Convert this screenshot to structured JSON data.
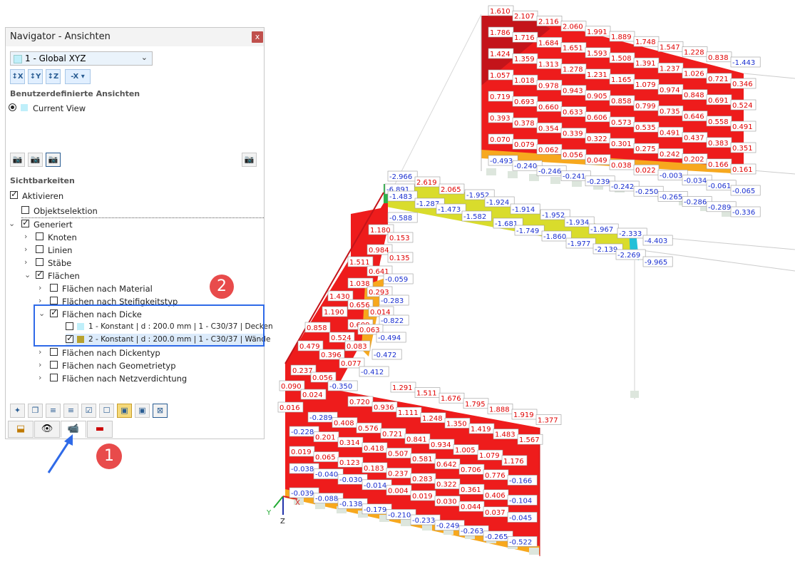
{
  "navigator": {
    "title": "Navigator - Ansichten",
    "close_label": "x",
    "view_select": "1 - Global XYZ",
    "axis_buttons": [
      "Ṫ X",
      "Y",
      "Z",
      "-X"
    ],
    "section_user_views": "Benutzerdefinierte Ansichten",
    "current_view": "Current View",
    "section_visibility": "Sichtbarkeiten",
    "tree": {
      "activate": "Aktivieren",
      "object_selection": "Objektselektion",
      "generated": "Generiert",
      "nodes": "Knoten",
      "lines": "Linien",
      "members": "Stäbe",
      "surfaces": "Flächen",
      "by_material": "Flächen nach Material",
      "by_stiffness": "Flächen nach Steifigkeitstyp",
      "by_thickness": "Flächen nach Dicke",
      "thickness_1": "1 - Konstant | d : 200.0 mm | 1 - C30/37 | Decken",
      "thickness_2": "2 - Konstant | d : 200.0 mm | 1 - C30/37 | Wände",
      "by_thickness_type": "Flächen nach Dickentyp",
      "by_geometry": "Flächen nach Geometrietyp",
      "by_mesh": "Flächen nach Netzverdichtung"
    },
    "colors": {
      "thickness_1": "#bfeffa",
      "thickness_2": "#b8a22e"
    }
  },
  "markers": {
    "one": "1",
    "two": "2"
  },
  "viewport": {
    "axis_labels": {
      "x": "X",
      "y": "Y",
      "z": "Z"
    },
    "colors": {
      "red": "#ee1c1c",
      "darkred": "#c4141a",
      "orange": "#f7a81e",
      "yellow": "#d9dc2c",
      "pos_text": "#e00000",
      "neg_text": "#1a2fd0"
    },
    "top_wall_labels": [
      "1.610",
      "2.107",
      "2.116",
      "2.060",
      "1.991",
      "1.889",
      "1.748",
      "1.547",
      "1.228",
      "0.838",
      "-1.443",
      "1.786",
      "1.716",
      "1.684",
      "1.651",
      "1.593",
      "1.508",
      "1.391",
      "1.237",
      "1.026",
      "0.721",
      "0.346",
      "1.424",
      "1.359",
      "1.313",
      "1.278",
      "1.231",
      "1.165",
      "1.079",
      "0.974",
      "0.848",
      "0.691",
      "0.524",
      "1.057",
      "1.018",
      "0.978",
      "0.943",
      "0.905",
      "0.858",
      "0.799",
      "0.735",
      "0.646",
      "0.558",
      "0.491",
      "0.719",
      "0.693",
      "0.660",
      "0.633",
      "0.606",
      "0.573",
      "0.535",
      "0.491",
      "0.437",
      "0.383",
      "0.351",
      "0.393",
      "0.378",
      "0.354",
      "0.339",
      "0.322",
      "0.301",
      "0.275",
      "0.242",
      "0.202",
      "0.166",
      "0.161",
      "0.070",
      "0.079",
      "0.062",
      "0.056",
      "0.049",
      "0.038",
      "0.022",
      "-0.003",
      "-0.034",
      "-0.061",
      "-0.065",
      "-0.493",
      "-0.240",
      "-0.246",
      "-0.241",
      "-0.239",
      "-0.242",
      "-0.250",
      "-0.265",
      "-0.286",
      "-0.289",
      "-0.336"
    ],
    "beam_labels": [
      "-2.966",
      "-6.891",
      "2.619",
      "-1.483",
      "2.065",
      "-1.952",
      "-1.287",
      "-1.473",
      "-1.582",
      "-1.924",
      "-1.914",
      "-1.952",
      "-1.934",
      "-1.967",
      "-2.333",
      "-4.403",
      "-0.588",
      "-1.681",
      "-1.749",
      "-1.860",
      "-1.977",
      "-2.139",
      "-2.269",
      "-9.965"
    ],
    "side_wall_labels": [
      "1.180",
      "0.153",
      "0.984",
      "0.135",
      "1.511",
      "0.641",
      "-0.059",
      "1.038",
      "0.293",
      "1.430",
      "0.656",
      "-0.283",
      "1.190",
      "0.609",
      "0.014",
      "-0.822",
      "0.858",
      "0.524",
      "0.063",
      "-0.494",
      "0.479",
      "0.396",
      "0.083",
      "-0.472",
      "0.237",
      "0.077",
      "-0.412",
      "0.056",
      "0.090",
      "0.024",
      "-0.350",
      "0.016"
    ],
    "bottom_wall_labels": [
      "1.291",
      "1.511",
      "1.676",
      "1.795",
      "1.888",
      "1.919",
      "1.377",
      "0.720",
      "0.936",
      "1.111",
      "1.248",
      "1.350",
      "1.419",
      "1.483",
      "1.567",
      "-0.289",
      "0.408",
      "0.576",
      "0.721",
      "0.841",
      "0.934",
      "1.005",
      "1.079",
      "1.176",
      "-0.228",
      "0.201",
      "0.314",
      "0.418",
      "0.507",
      "0.581",
      "0.642",
      "0.706",
      "0.776",
      "-0.166",
      "0.019",
      "0.065",
      "0.123",
      "0.183",
      "0.237",
      "0.283",
      "0.322",
      "0.361",
      "0.406",
      "-0.104",
      "-0.038",
      "-0.040",
      "-0.030",
      "-0.014",
      "0.004",
      "0.019",
      "0.030",
      "0.044",
      "0.037",
      "-0.045",
      "-0.039",
      "-0.088",
      "-0.138",
      "-0.179",
      "-0.210",
      "-0.233",
      "-0.249",
      "-0.263",
      "-0.265",
      "-0.522"
    ]
  }
}
